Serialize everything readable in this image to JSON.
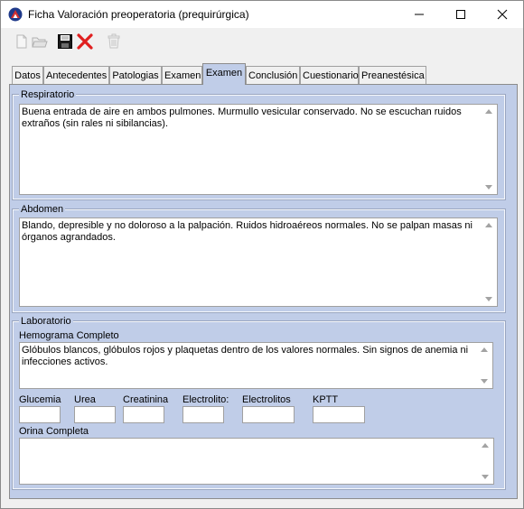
{
  "window": {
    "title": "Ficha Valoración preoperatoria (prequirúrgica)",
    "accent_color": "#c0cde8"
  },
  "toolbar": {
    "buttons": [
      {
        "name": "new-icon",
        "enabled": false
      },
      {
        "name": "open-icon",
        "enabled": false
      },
      {
        "name": "save-icon",
        "enabled": true
      },
      {
        "name": "delete-icon",
        "enabled": true
      },
      {
        "name": "trash-icon",
        "enabled": false
      }
    ]
  },
  "tabs": [
    {
      "label": "Datos"
    },
    {
      "label": "Antecedentes"
    },
    {
      "label": "Patologias"
    },
    {
      "label": "Examen"
    },
    {
      "label": "Examen",
      "active": true
    },
    {
      "label": "Conclusión"
    },
    {
      "label": "Cuestionario"
    },
    {
      "label": "Preanestésica"
    }
  ],
  "respiratorio": {
    "label": "Respiratorio",
    "text": "Buena entrada de aire en ambos pulmones. Murmullo vesicular conservado. No se escuchan ruidos extraños (sin rales ni sibilancias)."
  },
  "abdomen": {
    "label": "Abdomen",
    "text": "Blando, depresible y no doloroso a la palpación. Ruidos hidroaéreos normales. No se palpan masas ni órganos agrandados."
  },
  "laboratorio": {
    "label": "Laboratorio",
    "hemograma_label": "Hemograma Completo",
    "hemograma_text": "Glóbulos blancos, glóbulos rojos y plaquetas dentro de los valores normales. Sin signos de anemia ni infecciones activos.",
    "fields": {
      "glucemia": {
        "label": "Glucemia",
        "value": ""
      },
      "urea": {
        "label": "Urea",
        "value": ""
      },
      "creatinina": {
        "label": "Creatinina",
        "value": ""
      },
      "electrolito": {
        "label": "Electrolito:",
        "value": ""
      },
      "electrolitos": {
        "label": "Electrolitos",
        "value": ""
      },
      "kptt": {
        "label": "KPTT",
        "value": ""
      }
    },
    "orina_label": "Orina Completa",
    "orina_text": ""
  }
}
